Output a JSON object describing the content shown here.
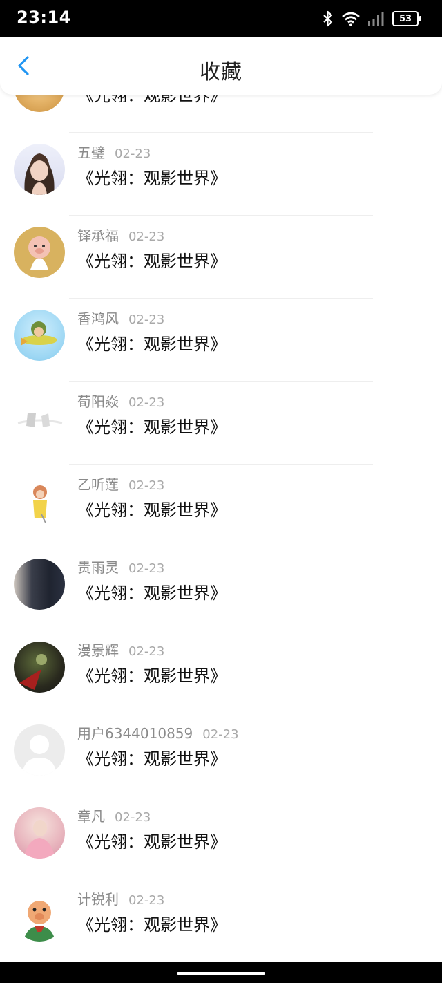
{
  "status_bar": {
    "time": "23:14",
    "battery": "53",
    "icons": [
      "bluetooth-icon",
      "wifi-icon",
      "signal-icon",
      "battery-icon"
    ]
  },
  "header": {
    "title": "收藏",
    "back_icon": "chevron-left-icon",
    "accent_color": "#2196F3"
  },
  "favorites": [
    {
      "name": "",
      "date": "",
      "content": "《光翎：观影世界》",
      "avatar": "food-avatar"
    },
    {
      "name": "五璧",
      "date": "02-23",
      "content": "《光翎：观影世界》",
      "avatar": "woman-avatar"
    },
    {
      "name": "铎承福",
      "date": "02-23",
      "content": "《光翎：观影世界》",
      "avatar": "cartoon-pig-avatar"
    },
    {
      "name": "香鸿风",
      "date": "02-23",
      "content": "《光翎：观影世界》",
      "avatar": "cartoon-plane-avatar"
    },
    {
      "name": "荀阳焱",
      "date": "02-23",
      "content": "《光翎：观影世界》",
      "avatar": "sketch-avatar"
    },
    {
      "name": "乙听莲",
      "date": "02-23",
      "content": "《光翎：观影世界》",
      "avatar": "cartoon-girl-avatar"
    },
    {
      "name": "贵雨灵",
      "date": "02-23",
      "content": "《光翎：观影世界》",
      "avatar": "dark-hair-avatar"
    },
    {
      "name": "漫景辉",
      "date": "02-23",
      "content": "《光翎：观影世界》",
      "avatar": "warrior-avatar"
    },
    {
      "name": "用户6344010859",
      "date": "02-23",
      "content": "《光翎：观影世界》",
      "avatar": "default-user-avatar"
    },
    {
      "name": "章凡",
      "date": "02-23",
      "content": "《光翎：观影世界》",
      "avatar": "pink-avatar"
    },
    {
      "name": "计锐利",
      "date": "02-23",
      "content": "《光翎：观影世界》",
      "avatar": "cartoon-pig-green-avatar"
    }
  ]
}
